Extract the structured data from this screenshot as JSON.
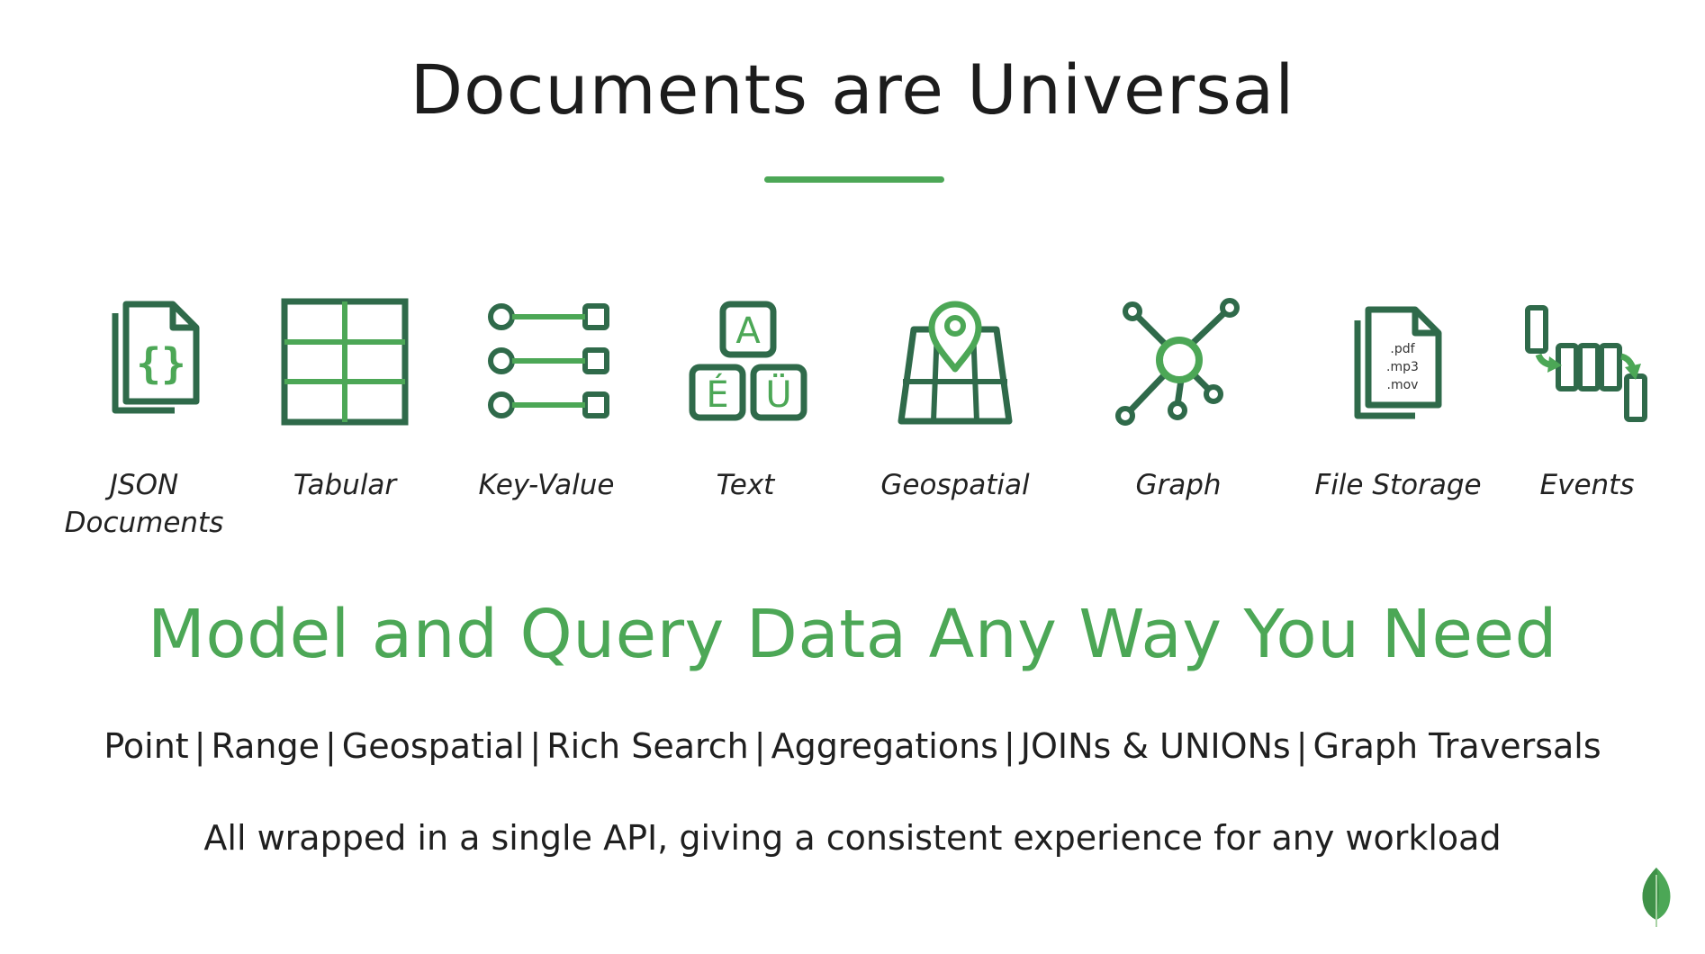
{
  "slide": {
    "title": "Documents are Universal",
    "headline": "Model and Query Data Any Way You Need",
    "operations": [
      "Point",
      "Range",
      "Geospatial",
      "Rich Search",
      "Aggregations",
      "JOINs & UNIONs",
      "Graph Traversals"
    ],
    "operations_separator": "|",
    "tagline": "All wrapped in a single API, giving a consistent experience for any workload"
  },
  "models": [
    {
      "label": "JSON Documents",
      "icon": "json-document-icon",
      "glyph": "{}"
    },
    {
      "label": "Tabular",
      "icon": "table-icon"
    },
    {
      "label": "Key-Value",
      "icon": "key-value-icon"
    },
    {
      "label": "Text",
      "icon": "text-characters-icon",
      "glyphs": [
        "A",
        "É",
        "Ü"
      ]
    },
    {
      "label": "Geospatial",
      "icon": "map-pin-icon"
    },
    {
      "label": "Graph",
      "icon": "graph-nodes-icon"
    },
    {
      "label": "File Storage",
      "icon": "file-storage-icon",
      "file_types": [
        ".pdf",
        ".mp3",
        ".mov"
      ]
    },
    {
      "label": "Events",
      "icon": "events-icon"
    }
  ],
  "colors": {
    "dark_green": "#2f6a4a",
    "green": "#4ca756",
    "text": "#1f1f1f"
  },
  "logo": {
    "icon": "mongodb-leaf-icon"
  }
}
